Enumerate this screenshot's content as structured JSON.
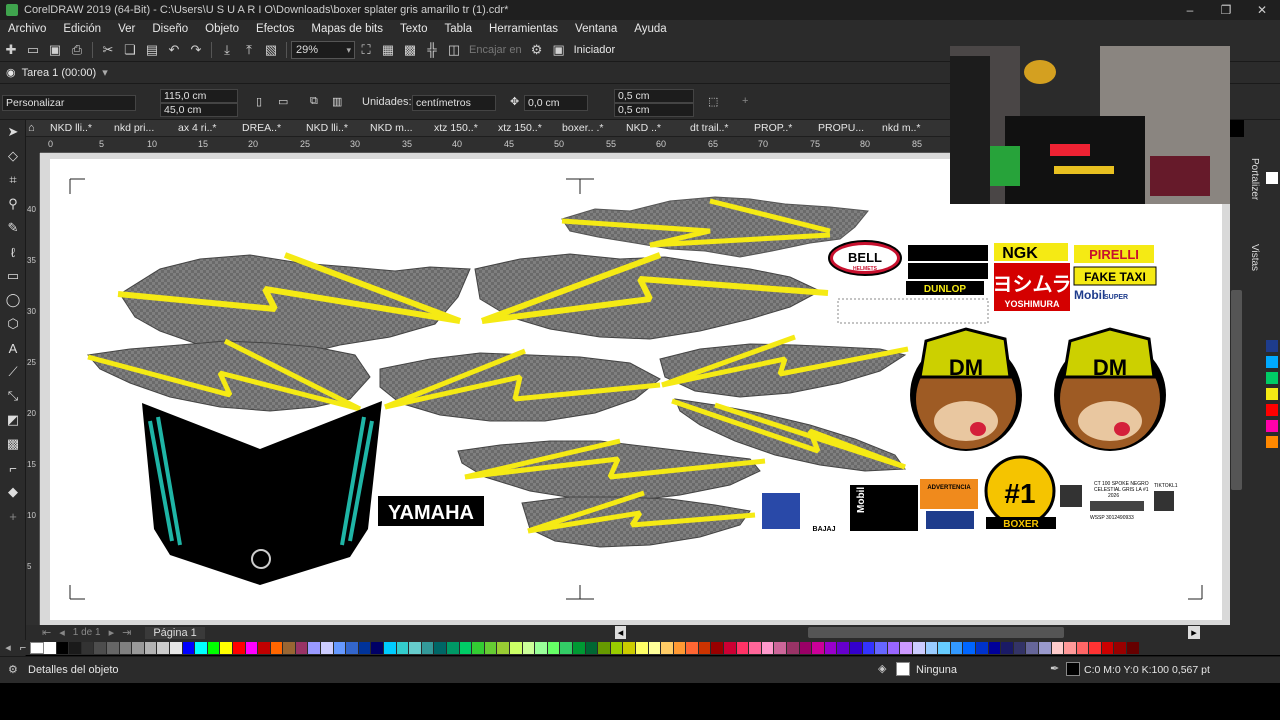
{
  "window": {
    "title": "CorelDRAW 2019 (64-Bit) - C:\\Users\\U S U A R I O\\Downloads\\boxer splater gris amarillo tr (1).cdr*"
  },
  "menu": [
    "Archivo",
    "Edición",
    "Ver",
    "Diseño",
    "Objeto",
    "Efectos",
    "Mapas de bits",
    "Texto",
    "Tabla",
    "Herramientas",
    "Ventana",
    "Ayuda"
  ],
  "toolbar": {
    "zoom": "29%",
    "snap_label": "Encajar en",
    "launcher_label": "Iniciador"
  },
  "task": {
    "label": "Tarea 1 (00:00)"
  },
  "properties": {
    "preset": "Personalizar",
    "width": "115,0 cm",
    "height": "45,0 cm",
    "units_label": "Unidades:",
    "units_value": "centímetros",
    "nudge": "0,0 cm",
    "dup_x": "0,5 cm",
    "dup_y": "0,5 cm"
  },
  "doc_tabs": [
    "NKD lli..*",
    "nkd pri...",
    "ax 4  ri..*",
    "DREA..*",
    "NKD lli..*",
    "NKD  m...",
    "xtz 150..*",
    "xtz 150..*",
    "boxer.. .*",
    "NKD  ..*",
    "dt trail..*",
    "PROP..*",
    "PROPU...",
    "nkd m..*"
  ],
  "ruler_h": [
    "0",
    "5",
    "10",
    "15",
    "20",
    "25",
    "30",
    "35",
    "40",
    "45",
    "50",
    "55",
    "60",
    "65",
    "70",
    "75",
    "80",
    "85"
  ],
  "ruler_v": [
    "40",
    "35",
    "30",
    "25",
    "20",
    "15",
    "10",
    "5"
  ],
  "pager": {
    "page_label": "Página 1",
    "counter": "1  de  1"
  },
  "dockers": {
    "tab1": "Portalizer",
    "tab2": "Vistas"
  },
  "status": {
    "object_details": "Detalles del objeto",
    "fill": "Ninguna",
    "outline": "C:0 M:0 Y:0 K:100  0,567 pt"
  },
  "artwork": {
    "yamaha": "YAMAHA",
    "bell": "BELL",
    "bell_sub": "HELMETS",
    "ngk": "NGK",
    "pirelli": "PIRELLI",
    "dunlop": "DUNLOP",
    "fake_taxi": "FAKE TAXI",
    "yoshimura": "YOSHIMURA",
    "yoshimura_kana": "ヨシムラ",
    "mobil": "Mobil",
    "mobil_super": "SUPER",
    "dm": "DM",
    "boxer_number": "#1",
    "boxer_brand": "BOXER",
    "specs_1": "CT 100  SPOKE NEGRO",
    "specs_2": "CELESTIAL GRIS LA #1",
    "specs_3": "2026",
    "specs_4": "WSSP 3012490933",
    "tiktok": "TIKTOKL1",
    "bajaj": "BAJAJ",
    "advertencia": "ADVERTENCIA",
    "mobil_vertical": "Mobil"
  },
  "colors": {
    "accent_yellow": "#f5ea14",
    "teal": "#1fb5a6",
    "gray_splatter": "#8c8c8c"
  },
  "palette": [
    "#ffffff",
    "#000000",
    "#1a1a1a",
    "#333333",
    "#4d4d4d",
    "#666666",
    "#808080",
    "#999999",
    "#b3b3b3",
    "#cccccc",
    "#e6e6e6",
    "#0000ff",
    "#00ffff",
    "#00ff00",
    "#ffff00",
    "#ff0000",
    "#ff00ff",
    "#c00000",
    "#ff6600",
    "#996633",
    "#993366",
    "#9999ff",
    "#ccccff",
    "#6699ff",
    "#3366cc",
    "#003399",
    "#000066",
    "#00ccff",
    "#33cccc",
    "#66cccc",
    "#339999",
    "#006666",
    "#009966",
    "#00cc66",
    "#33cc33",
    "#66cc33",
    "#99cc33",
    "#ccff66",
    "#ccff99",
    "#99ff99",
    "#66ff66",
    "#33cc66",
    "#009933",
    "#006633",
    "#669900",
    "#99cc00",
    "#cccc00",
    "#ffff66",
    "#ffff99",
    "#ffcc66",
    "#ff9933",
    "#ff6633",
    "#cc3300",
    "#990000",
    "#cc0033",
    "#ff3366",
    "#ff6699",
    "#ff99cc",
    "#cc6699",
    "#993366",
    "#990066",
    "#cc0099",
    "#9900cc",
    "#6600cc",
    "#3300cc",
    "#3333ff",
    "#6666ff",
    "#9966ff",
    "#cc99ff",
    "#ccccff",
    "#99ccff",
    "#66ccff",
    "#3399ff",
    "#0066ff",
    "#0033cc",
    "#000099",
    "#1a1a66",
    "#333366",
    "#666699",
    "#9999cc",
    "#ffcccc",
    "#ff9999",
    "#ff6666",
    "#ff3333",
    "#cc0000",
    "#990000",
    "#660000"
  ]
}
